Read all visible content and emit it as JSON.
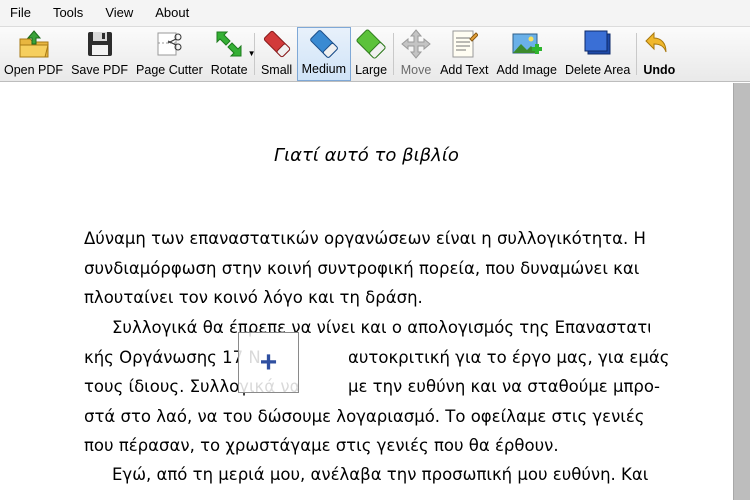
{
  "menu": [
    "File",
    "Tools",
    "View",
    "About"
  ],
  "toolbar": {
    "open_pdf": "Open PDF",
    "save_pdf": "Save PDF",
    "page_cutter": "Page Cutter",
    "rotate": "Rotate",
    "small": "Small",
    "medium": "Medium",
    "large": "Large",
    "move": "Move",
    "add_text": "Add Text",
    "add_image": "Add Image",
    "delete_area": "Delete Area",
    "undo": "Undo"
  },
  "document": {
    "title": "Γιατί αυτό το βιβλίο",
    "paragraph1": [
      "Δύναμη των επαναστατικών οργανώσεων είναι η συλλογικότητα. Η",
      "συνδιαμόρφωση στην κοινή συντροφική πορεία, που δυναμώνει και",
      "πλουταίνει τον κοινό λόγο και τη δράση."
    ],
    "paragraph2": [
      "Συλλογικά θα έπρεπε να νίνει και ο απολογισμός της Επαναστατι-",
      "κής Οργάνωσης 17 Ν",
      "αυτοκριτική για το έργο μας, για εμάς",
      "τους ίδιους. Συλλογικά να",
      "με την ευθύνη και να σταθούμε μπρο-",
      "στά στο λαό, να του δώσουμε λογαριασμό. Το οφείλαμε στις γενιές",
      "που πέρασαν, το χρωστάγαμε στις γενιές που θα έρθουν."
    ],
    "paragraph3": [
      "Εγώ, από τη μεριά μου, ανέλαβα την προσωπική μου ευθύνη. Και"
    ]
  }
}
